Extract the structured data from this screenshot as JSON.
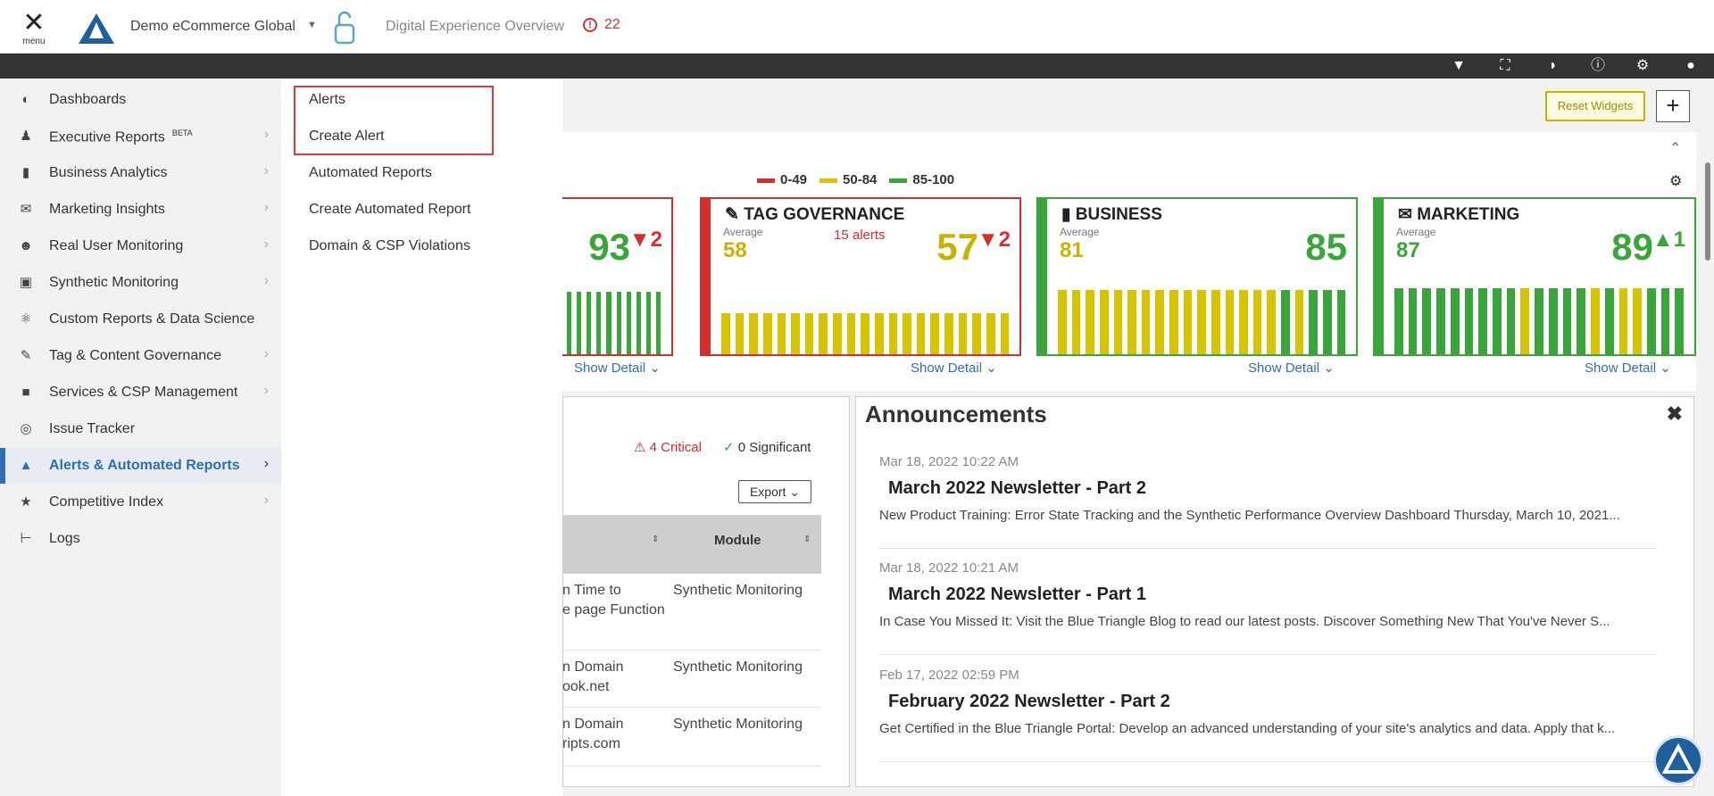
{
  "header": {
    "menu_label": "menu",
    "org_name": "Demo eCommerce Global",
    "page_title": "Digital Experience Overview",
    "alert_count": "22",
    "brand_color": "#1f5f9c"
  },
  "toolbar": {
    "icons": [
      "filter-icon",
      "fullscreen-icon",
      "contrast-icon",
      "help-icon",
      "settings-icon",
      "user-icon"
    ]
  },
  "dashboard": {
    "reset_widgets": "Reset Widgets",
    "add_label": "+",
    "legend": [
      {
        "label": "0-49",
        "color": "#d32f2f"
      },
      {
        "label": "50-84",
        "color": "#d6c400"
      },
      {
        "label": "85-100",
        "color": "#3aa53a"
      }
    ],
    "cards": [
      {
        "title": "",
        "avg_label": "",
        "avg": "",
        "alerts": "",
        "score": "93",
        "delta": "2",
        "trend": "down",
        "status": "red",
        "show_detail": "Show Detail"
      },
      {
        "title": "TAG GOVERNANCE",
        "avg_label": "Average",
        "avg": "58",
        "alerts": "15 alerts",
        "score": "57",
        "delta": "2",
        "trend": "down",
        "status": "red",
        "show_detail": "Show Detail"
      },
      {
        "title": "BUSINESS",
        "avg_label": "Average",
        "avg": "81",
        "alerts": "",
        "score": "85",
        "delta": "",
        "trend": "",
        "status": "green",
        "show_detail": "Show Detail"
      },
      {
        "title": "MARKETING",
        "avg_label": "Average",
        "avg": "87",
        "alerts": "",
        "score": "89",
        "delta": "1",
        "trend": "up",
        "status": "green",
        "show_detail": "Show Detail"
      }
    ],
    "issues": {
      "critical": "4 Critical",
      "significant": "0 Significant",
      "export_label": "Export",
      "column_module": "Module",
      "rows": [
        {
          "text": "n Time to\ne page Function",
          "module": "Synthetic Monitoring"
        },
        {
          "text": "n Domain\nook.net",
          "module": "Synthetic Monitoring"
        },
        {
          "text": "n Domain\nripts.com",
          "module": "Synthetic Monitoring"
        }
      ]
    },
    "announcements": {
      "title": "Announcements",
      "items": [
        {
          "date": "Mar 18, 2022 10:22 AM",
          "title": "March 2022 Newsletter - Part 2",
          "body": "New Product Training:  Error State Tracking and the Synthetic Performance Overview Dashboard Thursday, March 10, 2021..."
        },
        {
          "date": "Mar 18, 2022 10:21 AM",
          "title": "March 2022 Newsletter - Part 1",
          "body": "In Case You Missed It: Visit the Blue Triangle Blog to read our latest posts.   Discover Something New That You've Never S..."
        },
        {
          "date": "Feb 17, 2022 02:59 PM",
          "title": "February 2022 Newsletter - Part 2",
          "body": "Get Certified in the Blue Triangle Portal: Develop an advanced understanding of your site's analytics and data. Apply that k..."
        }
      ]
    }
  },
  "sidebar": {
    "items": [
      {
        "label": "Dashboards",
        "icon": "dashboard-icon",
        "chevron": false
      },
      {
        "label": "Executive Reports",
        "icon": "executive-icon",
        "badge": "BETA",
        "chevron": true
      },
      {
        "label": "Business Analytics",
        "icon": "bar-chart-icon",
        "chevron": true
      },
      {
        "label": "Marketing Insights",
        "icon": "megaphone-icon",
        "chevron": true
      },
      {
        "label": "Real User Monitoring",
        "icon": "users-icon",
        "chevron": true
      },
      {
        "label": "Synthetic Monitoring",
        "icon": "robot-icon",
        "chevron": true
      },
      {
        "label": "Custom Reports & Data Science",
        "icon": "atom-icon",
        "chevron": false
      },
      {
        "label": "Tag & Content Governance",
        "icon": "tag-icon",
        "chevron": true
      },
      {
        "label": "Services & CSP Management",
        "icon": "lock-icon",
        "chevron": true
      },
      {
        "label": "Issue Tracker",
        "icon": "radar-icon",
        "chevron": false
      },
      {
        "label": "Alerts & Automated Reports",
        "icon": "bell-icon",
        "chevron": true,
        "active": true
      },
      {
        "label": "Competitive Index",
        "icon": "trophy-icon",
        "chevron": true
      },
      {
        "label": "Logs",
        "icon": "logs-icon",
        "chevron": false
      }
    ]
  },
  "submenu": {
    "items": [
      "Alerts",
      "Create Alert",
      "Automated Reports",
      "Create Automated Report",
      "Domain & CSP Violations"
    ]
  }
}
